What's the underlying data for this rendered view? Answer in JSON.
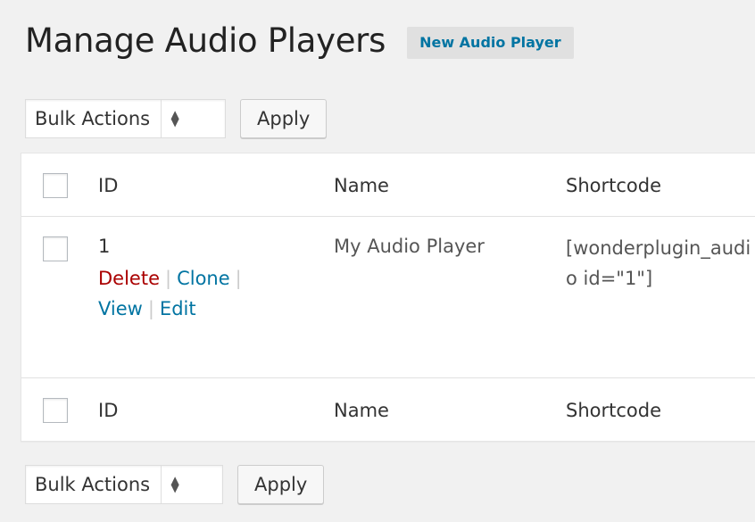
{
  "page": {
    "title": "Manage Audio Players",
    "add_new_label": "New Audio Player"
  },
  "bulk_top": {
    "selected_option": "Bulk Actions",
    "apply_label": "Apply"
  },
  "bulk_bottom": {
    "selected_option": "Bulk Actions",
    "apply_label": "Apply"
  },
  "table": {
    "columns": [
      "ID",
      "Name",
      "Shortcode"
    ],
    "rows": [
      {
        "id": "1",
        "name": "My Audio Player",
        "shortcode": "[wonderplugin_audio id=\"1\"]",
        "actions": {
          "delete": "Delete",
          "clone": "Clone",
          "view": "View",
          "edit": "Edit"
        }
      }
    ],
    "separator": "|"
  },
  "colors": {
    "link": "#0074a2",
    "delete": "#aa0000",
    "background": "#f1f1f1"
  }
}
